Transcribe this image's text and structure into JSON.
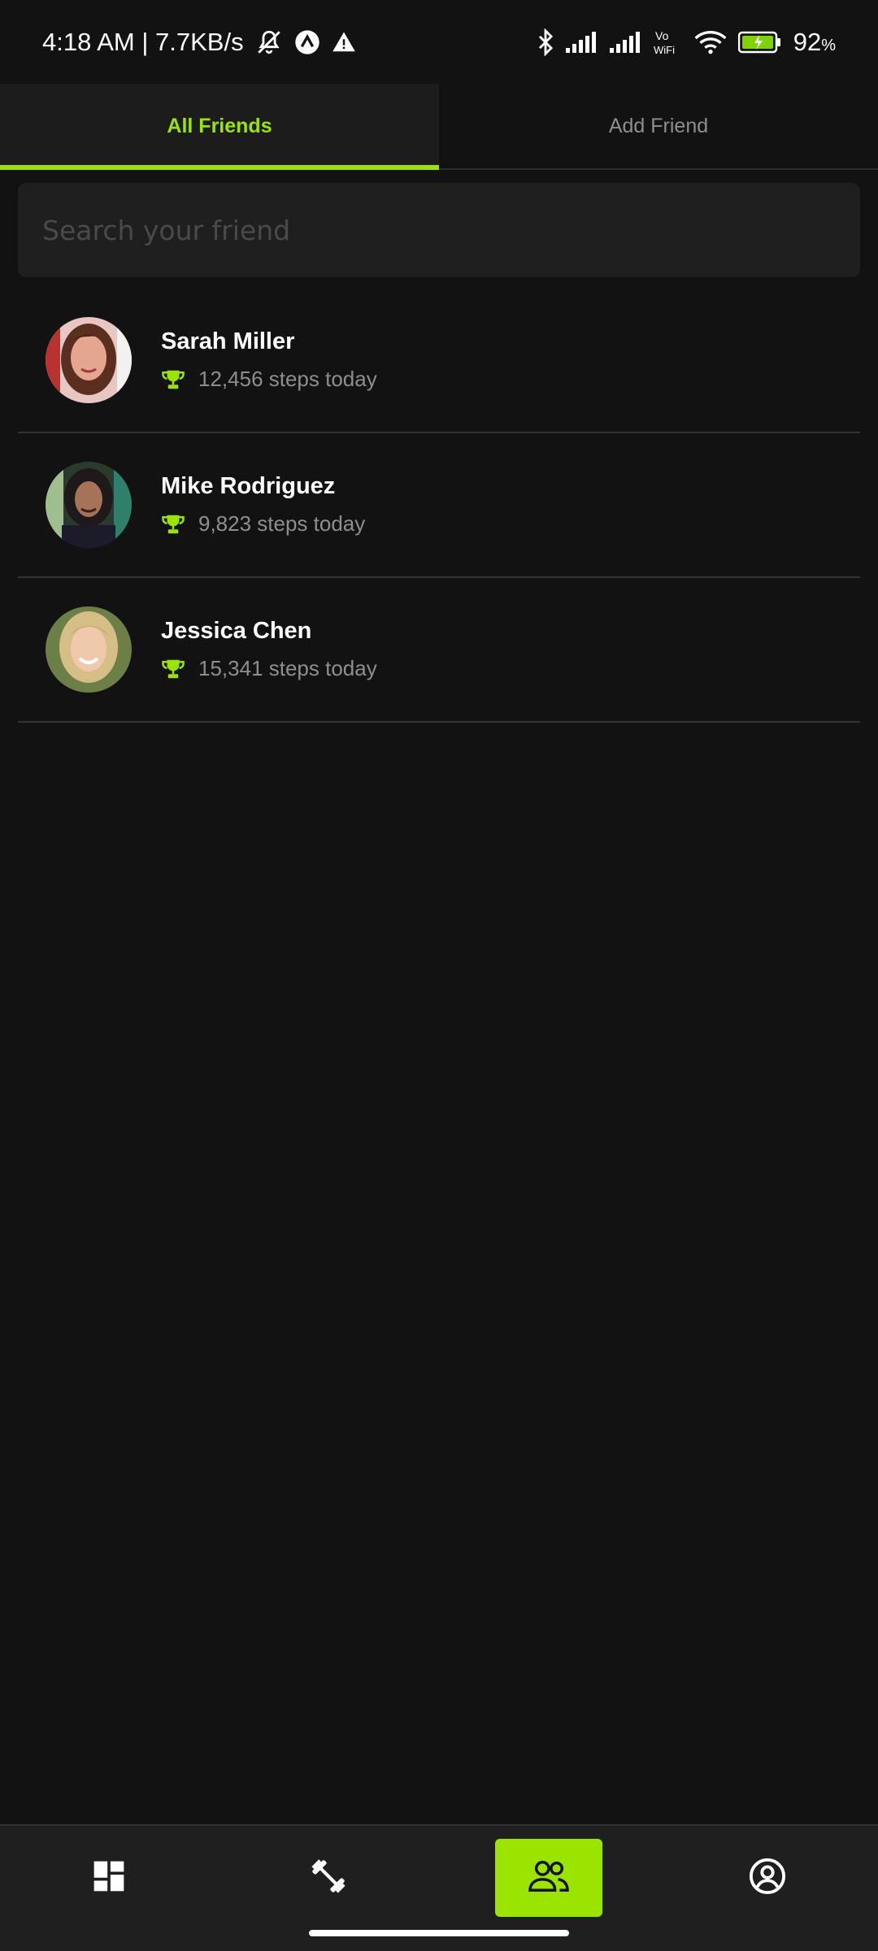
{
  "status_bar": {
    "time_net": "4:18 AM | 7.7KB/s",
    "battery": "92",
    "battery_unit": "%"
  },
  "tabs": [
    {
      "label": "All Friends",
      "active": true
    },
    {
      "label": "Add Friend",
      "active": false
    }
  ],
  "search": {
    "placeholder": "Search your friend",
    "value": ""
  },
  "friends": [
    {
      "name": "Sarah Miller",
      "steps": "12,456 steps today"
    },
    {
      "name": "Mike Rodriguez",
      "steps": "9,823 steps today"
    },
    {
      "name": "Jessica Chen",
      "steps": "15,341 steps today"
    }
  ],
  "bottom_nav": [
    {
      "icon": "dashboard-icon",
      "active": false
    },
    {
      "icon": "dumbbell-icon",
      "active": false
    },
    {
      "icon": "friends-icon",
      "active": true
    },
    {
      "icon": "profile-icon",
      "active": false
    }
  ],
  "colors": {
    "accent": "#9be400",
    "background": "#121212",
    "surface": "#1f1f1f",
    "muted": "#8e8e8e"
  }
}
